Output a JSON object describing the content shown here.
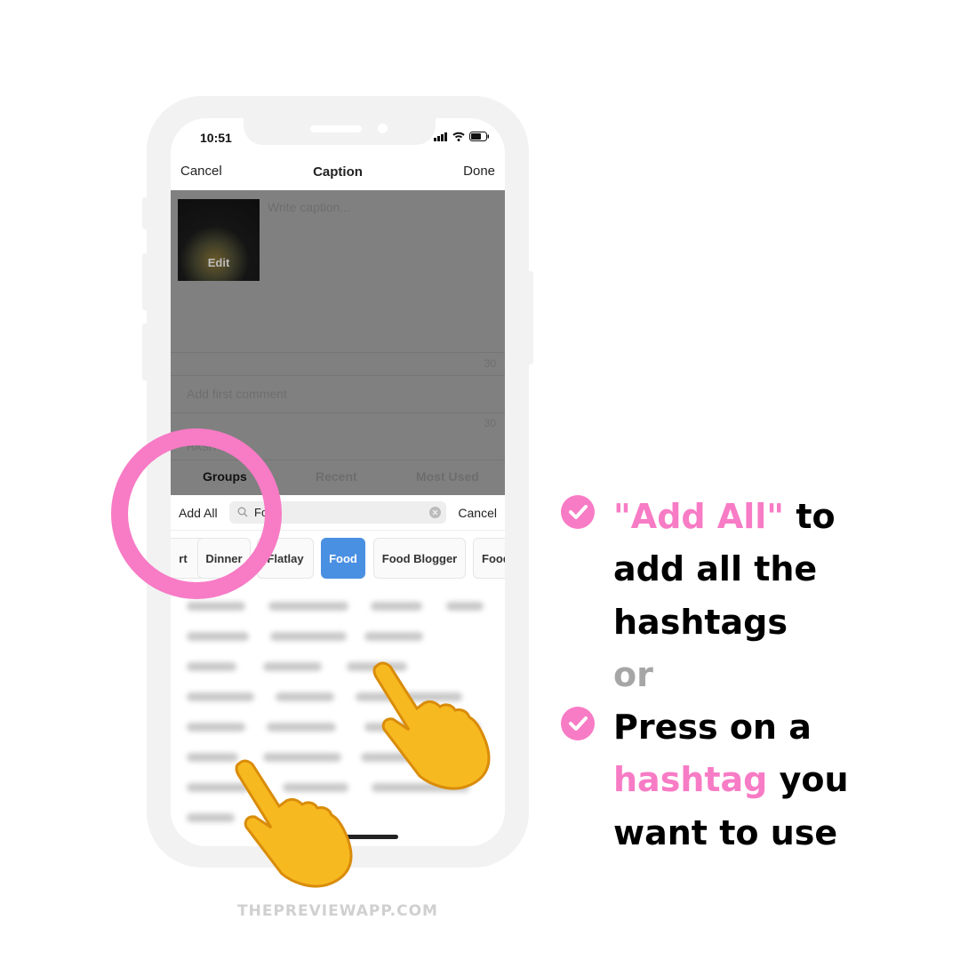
{
  "status_bar": {
    "time": "10:51"
  },
  "nav": {
    "cancel": "Cancel",
    "title": "Caption",
    "done": "Done"
  },
  "post": {
    "thumb_label": "Edit",
    "caption_placeholder": "Write caption...",
    "caption_count": "30",
    "comment_placeholder": "Add first comment",
    "comment_count": "30",
    "hashtags_label": "HASHT"
  },
  "tabs": [
    {
      "label": "Groups",
      "active": true
    },
    {
      "label": "Recent"
    },
    {
      "label": "Most Used"
    }
  ],
  "search": {
    "add_all": "Add All",
    "value": "Fo",
    "cancel": "Cancel"
  },
  "chips": [
    {
      "label": "rt"
    },
    {
      "label": "Dinner"
    },
    {
      "label": "Flatlay"
    },
    {
      "label": "Food",
      "active": true
    },
    {
      "label": "Food Blogger"
    },
    {
      "label": "Food"
    }
  ],
  "instructions": {
    "l1a": "\"Add All\"",
    "l1b": " to",
    "l2": "add all the",
    "l3": "hashtags",
    "l4": "or",
    "l5": "Press on a",
    "l6a": "hashtag",
    "l6b": " you",
    "l7": "want to use"
  },
  "footer": "THEPREVIEWAPP.COM",
  "colors": {
    "accent_pink": "#f77bc5",
    "chip_active": "#4a90e2"
  }
}
